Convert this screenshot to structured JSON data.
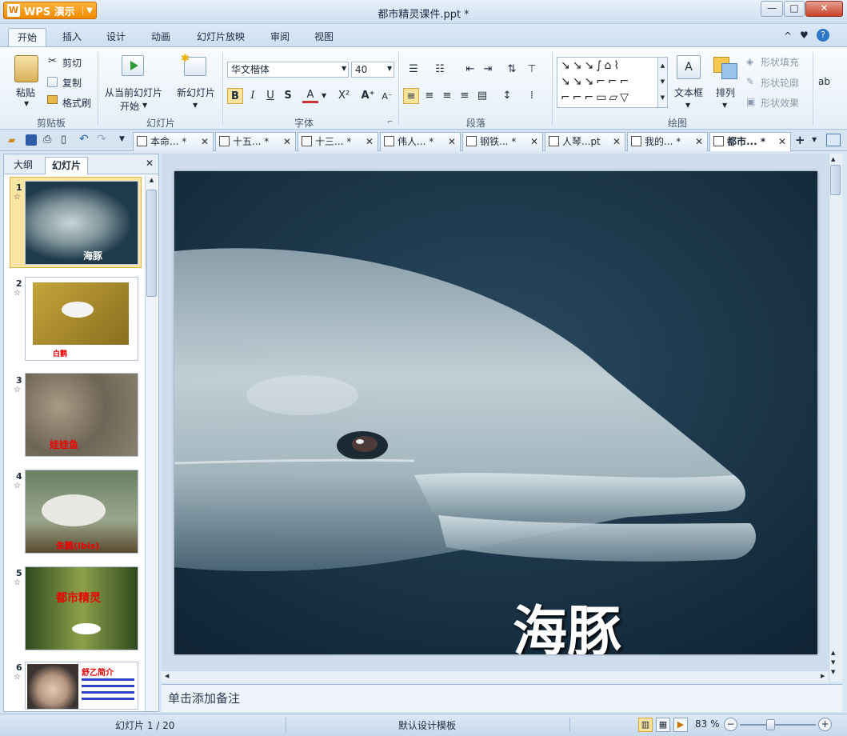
{
  "app": {
    "menu_button_label": "WPS 演示",
    "logo_glyph": "W",
    "document_title": "都市精灵课件.ppt *"
  },
  "window_controls": {
    "minimize": "—",
    "maximize": "□",
    "close": "✕"
  },
  "menu_tabs": [
    "开始",
    "插入",
    "设计",
    "动画",
    "幻灯片放映",
    "审阅",
    "视图"
  ],
  "ribbon": {
    "clipboard": {
      "paste": "粘贴",
      "cut": "剪切",
      "copy": "复制",
      "format_painter": "格式刷",
      "label": "剪贴板"
    },
    "slides": {
      "play_from_current": "从当前幻灯片",
      "play_from_current_2": "开始",
      "new_slide": "新幻灯片",
      "label": "幻灯片"
    },
    "font": {
      "font_name": "华文楷体",
      "font_size": "40",
      "label": "字体"
    },
    "paragraph": {
      "label": "段落"
    },
    "drawing": {
      "textbox": "文本框",
      "arrange": "排列",
      "shape_fill": "形状填充",
      "shape_outline": "形状轮廓",
      "shape_effect": "形状效果",
      "label": "绘图"
    }
  },
  "doc_tabs": [
    "本命... *",
    "十五... *",
    "十三... *",
    "伟人... *",
    "钢铁... *",
    "人琴...pt",
    "我的... *",
    "都市... *"
  ],
  "panel": {
    "tab_outline": "大纲",
    "tab_slides": "幻灯片"
  },
  "thumbnails": [
    {
      "num": "1",
      "caption": "海豚"
    },
    {
      "num": "2",
      "caption": "白鹳"
    },
    {
      "num": "3",
      "caption": "娃娃鱼"
    },
    {
      "num": "4",
      "caption": "朱鹮(Ibis)"
    },
    {
      "num": "5",
      "caption": "都市精灵"
    },
    {
      "num": "6",
      "caption": "舒乙简介"
    }
  ],
  "slide": {
    "title": "海豚"
  },
  "notes_placeholder": "单击添加备注",
  "status": {
    "slide_position": "幻灯片 1 / 20",
    "template": "默认设计模板",
    "zoom": "83 %"
  }
}
